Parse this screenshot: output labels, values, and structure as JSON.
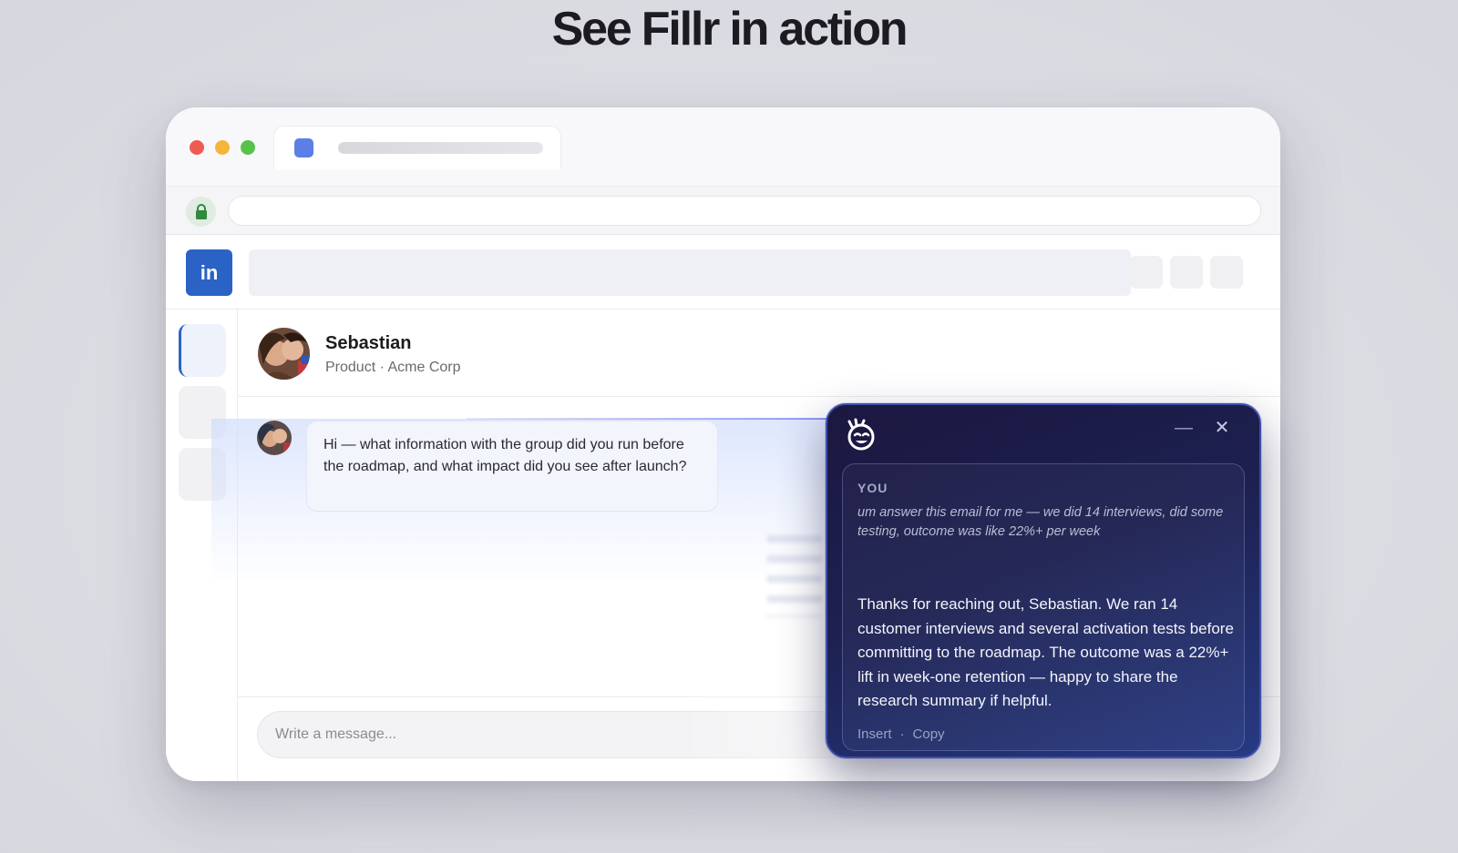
{
  "headline": "See Fillr in action",
  "site": {
    "logo": "in"
  },
  "contact": {
    "name": "Sebastian",
    "role": "Product · Acme Corp"
  },
  "message": {
    "text": "Hi — what information with the group did you run before the roadmap, and what impact did you see after launch?"
  },
  "composer": {
    "placeholder": "Write a message..."
  },
  "assistant": {
    "you_label": "YOU",
    "prompt": "um answer this email for me — we did 14 interviews, did some testing, outcome was like 22%+ per week",
    "reply": "Thanks for reaching out, Sebastian. We ran 14 customer interviews and several activation tests before committing to the roadmap. The outcome was a 22%+ lift in week-one retention — happy to share the research summary if helpful.",
    "insert_label": "Insert",
    "separator": "·",
    "copy_label": "Copy",
    "minimize_glyph": "—",
    "close_glyph": "✕"
  },
  "colors": {
    "linkedin_blue": "#2a63c5",
    "assistant_bg_start": "#1b1740",
    "assistant_bg_end": "#273a82",
    "traffic_red": "#ef5b52",
    "traffic_yellow": "#f4b53a",
    "traffic_green": "#58c14b"
  },
  "icons": {
    "lock": "lock-icon",
    "assistant_logo": "fillr-logo-icon",
    "minimize": "minimize-icon",
    "close": "close-icon"
  }
}
